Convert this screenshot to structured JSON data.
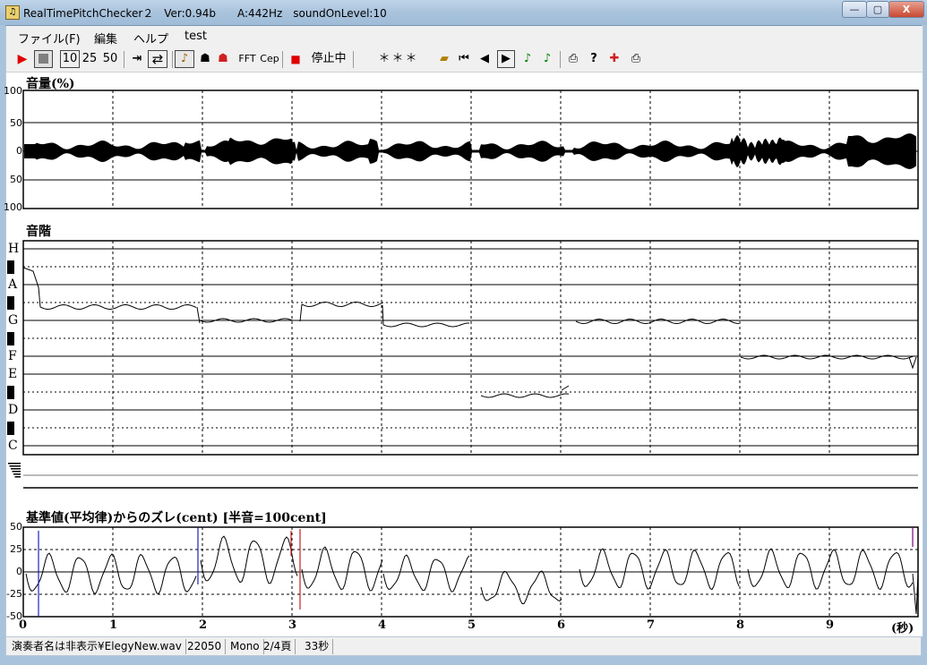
{
  "window": {
    "title": "RealTimePitchChecker２　Ver:0.94b　　A:442Hz　soundOnLevel:10",
    "min_label": "—",
    "max_label": "▢",
    "close_label": "X"
  },
  "menu": [
    "ファイル(F)",
    "編集",
    "ヘルプ",
    "test"
  ],
  "toolbar": {
    "speed_10": "10",
    "speed_25": "25",
    "speed_50": "50",
    "fft_label": "FFT",
    "cep_label": "Cep",
    "status": "停止中",
    "readout": "＊＊＊",
    "colors": {
      "play": "#e00000",
      "stop_rec": "#e00000",
      "note_green": "#008000"
    }
  },
  "volume_panel": {
    "title": "音量(%)",
    "ticks": [
      "100",
      "50",
      "0",
      "50",
      "100"
    ]
  },
  "scale_panel": {
    "title": "音階",
    "notes": [
      "H",
      "A",
      "G",
      "F",
      "E",
      "D",
      "C"
    ]
  },
  "cent_panel": {
    "title": "基準値(平均律)からのズレ(cent) [半音=100cent]",
    "ticks": [
      "50",
      "25",
      "0",
      "-25",
      "-50"
    ]
  },
  "time_axis": {
    "ticks": [
      "0",
      "1",
      "2",
      "3",
      "4",
      "5",
      "6",
      "7",
      "8",
      "9"
    ],
    "unit": "(秒)"
  },
  "status": {
    "performer": "演奏者名は非表示¥ElegyNew.wav",
    "rate": "22050",
    "channel": "Mono",
    "page": "2/4頁",
    "duration": "33秒"
  }
}
